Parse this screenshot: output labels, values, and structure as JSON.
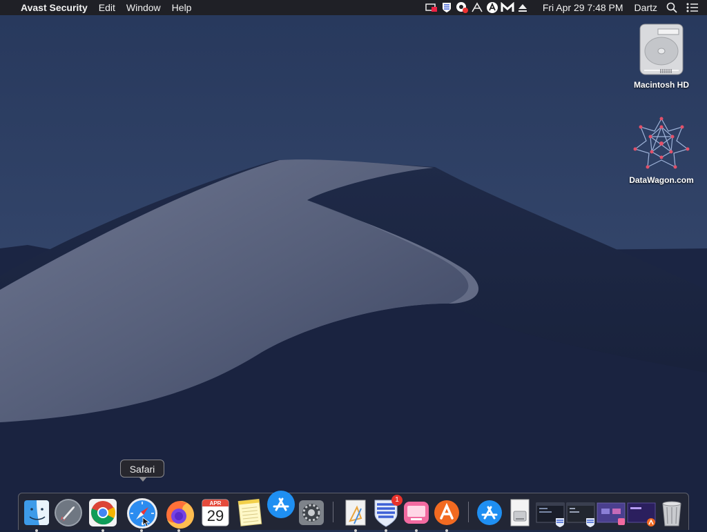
{
  "menubar": {
    "apple_symbol": "",
    "app_name": "Avast Security",
    "menus": [
      "Edit",
      "Window",
      "Help"
    ],
    "status_icons": [
      "display-mirroring-icon",
      "avast-shield-icon",
      "screen-record-icon",
      "app-status-icon",
      "avast-icon",
      "malwarebytes-icon",
      "eject-icon"
    ],
    "datetime": "Fri Apr 29  7:48 PM",
    "user": "Dartz",
    "spotlight_icon": "search-icon",
    "notification_icon": "notification-center-icon"
  },
  "desktop": {
    "icons": [
      {
        "label": "Macintosh HD",
        "icon": "hard-drive-icon"
      },
      {
        "label": "DataWagon.com",
        "icon": "datawagon-logo-icon"
      }
    ]
  },
  "dock": {
    "tooltip": "Safari",
    "calendar": {
      "month": "APR",
      "day": "29"
    },
    "badge_count": "1",
    "apps": [
      "Finder",
      "Launchpad",
      "Google Chrome",
      "Safari",
      "Firefox",
      "Calendar",
      "Notes",
      "App Store",
      "System Preferences",
      "Xcode Preview",
      "Avast Security",
      "CleanMyMac",
      "Avast Passwords",
      "App Store Downloads",
      "Disk Image",
      "Window 1",
      "Window 2",
      "Window 3",
      "Window 4",
      "Trash"
    ]
  },
  "colors": {
    "menubar": "#1e1e22",
    "dock": "#28282e",
    "avast_orange": "#f26a21",
    "badge": "#e8322c"
  }
}
